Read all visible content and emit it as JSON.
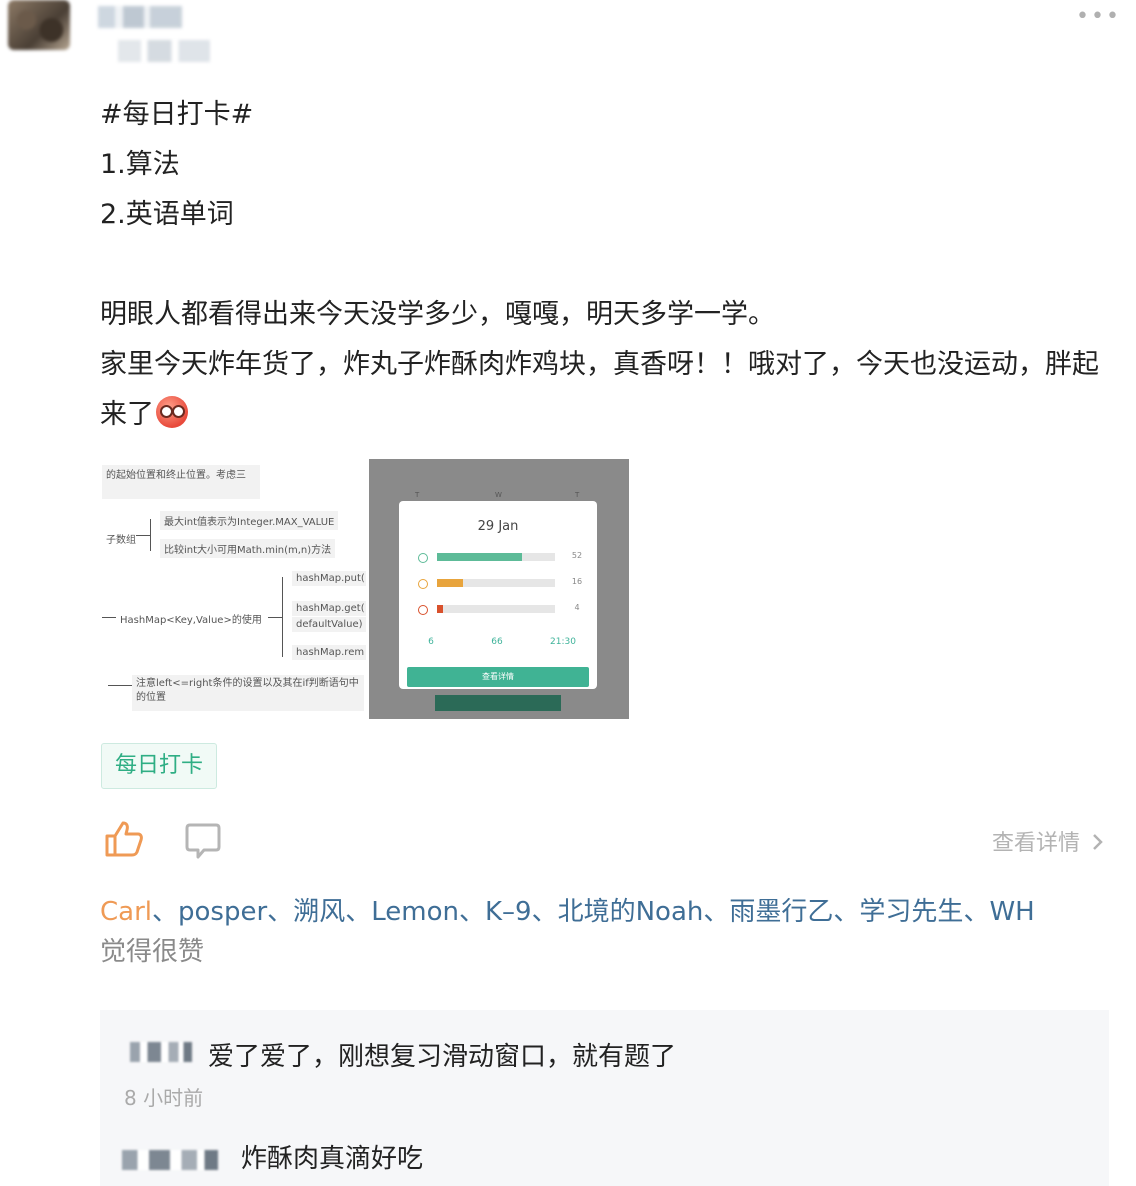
{
  "header": {
    "more_icon": "more-horizontal-icon",
    "more_label": "•••"
  },
  "post": {
    "lines": [
      "#每日打卡#",
      "1.算法",
      "2.英语单词"
    ],
    "paragraph1": "明眼人都看得出来今天没学多少，嘎嘎，明天多学一学。",
    "paragraph2": "家里今天炸年货了，炸丸子炸酥肉炸鸡块，真香呀！！哦对了，今天也没运动，胖起来了",
    "emoji": "flushed-face-icon"
  },
  "image_mindmap": {
    "nodes": [
      "的起始位置和终止位置。考虑三",
      "子数组",
      "最大int值表示为Integer.MAX_VALUE",
      "比较int大小可用Math.min(m,n)方法",
      "HashMap<Key,Value>的使用",
      "hashMap.put(",
      "hashMap.get(",
      "defaultValue)",
      "hashMap.rem",
      "注意left<=right条件的设置以及其在if判断语句中",
      "的位置"
    ]
  },
  "image_app": {
    "letters": [
      "T",
      "W",
      "T"
    ],
    "date": "29 Jan",
    "bars": [
      {
        "value": "52",
        "fraction": 0.72,
        "color": "#5dbb98",
        "icon_color": "#5dbb98"
      },
      {
        "value": "16",
        "fraction": 0.22,
        "color": "#e8a43c",
        "icon_color": "#e8a43c"
      },
      {
        "value": "4",
        "fraction": 0.05,
        "color": "#d9512c",
        "icon_color": "#d9512c"
      }
    ],
    "stats": [
      "6",
      "66",
      "21:30"
    ],
    "button": "查看详情"
  },
  "tag": {
    "label": "每日打卡"
  },
  "actions": {
    "like_icon": "thumbs-up-icon",
    "comment_icon": "comment-icon",
    "detail_label": "查看详情",
    "detail_icon": "chevron-right-icon"
  },
  "likers": {
    "names": [
      "Carl",
      "posper",
      "溯风",
      "Lemon",
      "K–9",
      "北境的Noah",
      "雨墨行乙",
      "学习先生",
      "WH"
    ],
    "separator": "、",
    "suffix": "觉得很赞"
  },
  "comments": [
    {
      "text": "爱了爱了，刚想复习滑动窗口，就有题了",
      "time": "8 小时前"
    },
    {
      "text": "炸酥肉真滴好吃",
      "time": ""
    }
  ]
}
